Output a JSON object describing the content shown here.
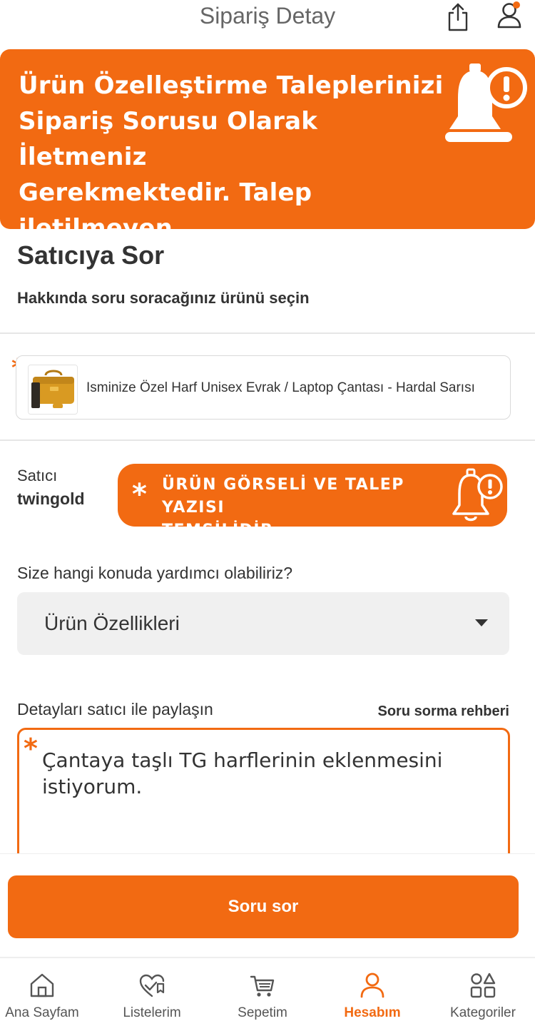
{
  "header": {
    "title": "Sipariş Detay",
    "share_icon": "share-icon",
    "user_icon": "user-icon"
  },
  "banner": {
    "text": "Ürün Özelleştirme Taleplerinizi\nSipariş Sorusu Olarak İletmeniz\nGerekmektedir. Talep iletilmeyen\nSiparişler Harfsiz Olarak Kargolanır.",
    "icon": "bell-alert-icon"
  },
  "ask": {
    "title": "Satıcıya Sor",
    "subtitle": "Hakkında soru soracağınız ürünü seçin"
  },
  "product": {
    "name": "Isminize Özel Harf Unisex Evrak / Laptop Çantası - Hardal Sarısı",
    "required_mark": "*"
  },
  "seller": {
    "label": "Satıcı",
    "name": "twingold"
  },
  "notice_pill": {
    "star": "*",
    "text": "ÜRÜN GÖRSELİ VE TALEP YAZISI\nTEMSİLİDİR",
    "icon": "bell-alert-icon"
  },
  "topic": {
    "label": "Size hangi konuda yardımcı olabiliriz?",
    "selected": "Ürün Özellikleri"
  },
  "details": {
    "label": "Detayları satıcı ile paylaşın",
    "guide": "Soru sorma rehberi",
    "value": "Çantaya taşlı TG harflerinin eklenmesini istiyorum.",
    "required_mark": "*"
  },
  "submit": {
    "label": "Soru sor"
  },
  "tabbar": {
    "items": [
      {
        "label": "Ana Sayfam",
        "icon": "home-icon"
      },
      {
        "label": "Listelerim",
        "icon": "heart-list-icon"
      },
      {
        "label": "Sepetim",
        "icon": "cart-icon"
      },
      {
        "label": "Hesabım",
        "icon": "account-icon",
        "active": true
      },
      {
        "label": "Kategoriler",
        "icon": "categories-icon"
      }
    ]
  },
  "colors": {
    "accent": "#f26a12",
    "text": "#333333",
    "muted": "#666666"
  }
}
